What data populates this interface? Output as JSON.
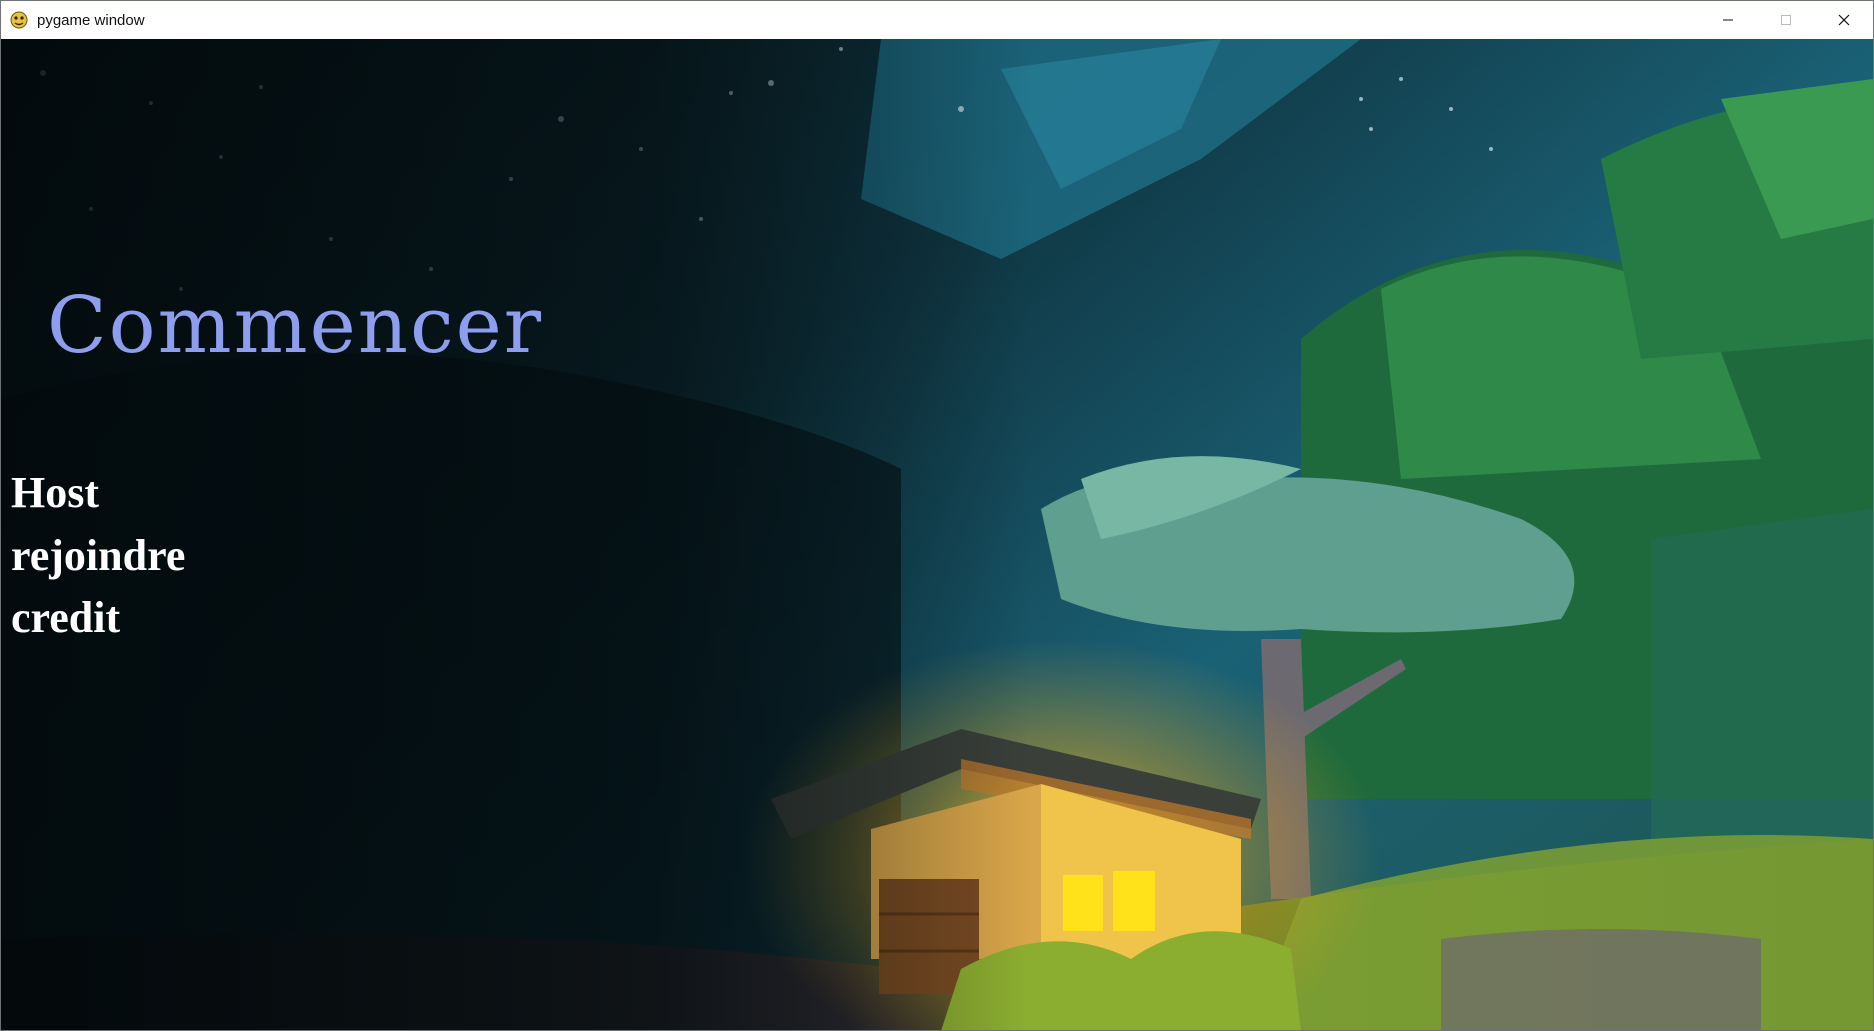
{
  "window": {
    "title": "pygame window",
    "app_icon": "pygame-snake-icon",
    "controls": [
      "minimize-icon",
      "maximize-icon",
      "close-icon"
    ]
  },
  "menu": {
    "title": "Commencer",
    "items": [
      {
        "id": "host",
        "label": "Host"
      },
      {
        "id": "join",
        "label": "rejoindre"
      },
      {
        "id": "credit",
        "label": "credit"
      }
    ]
  },
  "colors": {
    "title_text": "#8d9eee",
    "menu_text": "#ffffff",
    "sky_dark": "#061014",
    "sky_teal": "#1d6a80",
    "foliage_green": "#2f8a4a",
    "window_light": "#ffd21a"
  }
}
